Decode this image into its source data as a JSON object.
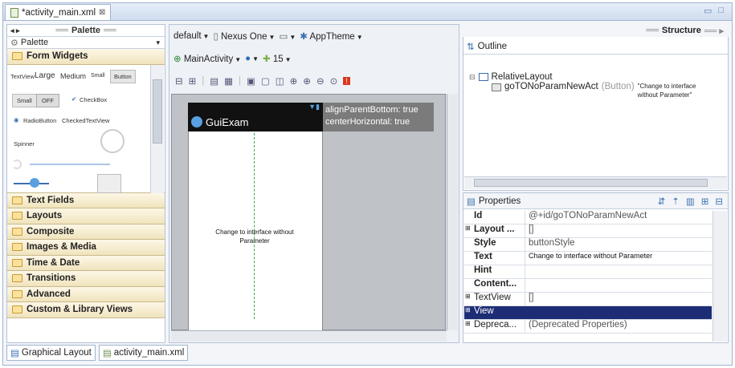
{
  "editor_tab": {
    "title": "*activity_main.xml",
    "close": "⊠"
  },
  "palette": {
    "header": "Palette",
    "selector": "Palette",
    "categories": [
      "Form Widgets",
      "Text Fields",
      "Layouts",
      "Composite",
      "Images & Media",
      "Time & Date",
      "Transitions",
      "Advanced",
      "Custom & Library Views"
    ],
    "widgets": {
      "textview": "TextView",
      "large": "Large",
      "medium": "Medium",
      "small": "Small",
      "button": "Button",
      "small_btn": "Small",
      "off": "OFF",
      "checkbox": "CheckBox",
      "radio": "RadioButton",
      "checked_tv": "CheckedTextView",
      "spinner": "Spinner"
    }
  },
  "toolbar": {
    "config": "default",
    "device": "Nexus One",
    "theme": "AppTheme",
    "activity": "MainActivity",
    "api": "15"
  },
  "canvas": {
    "app_title": "GuiExam",
    "hint_line1": "alignParentBottom: true",
    "hint_line2": "centerHorizontal: true",
    "button_text": "Change to interface without Parameter"
  },
  "structure": {
    "header": "Structure",
    "outline_title": "Outline",
    "root": "RelativeLayout",
    "child_name": "goTONoParamNewAct",
    "child_type": "(Button)",
    "child_text": "\"Change to interface without Parameter\""
  },
  "properties": {
    "title": "Properties",
    "rows": [
      {
        "key": "Id",
        "value": "@+id/goTONoParamNewAct"
      },
      {
        "key": "Layout ...",
        "value": "[]"
      },
      {
        "key": "Style",
        "value": "buttonStyle"
      },
      {
        "key": "Text",
        "value": "Change to interface without Parameter"
      },
      {
        "key": "Hint",
        "value": ""
      },
      {
        "key": "Content...",
        "value": ""
      },
      {
        "key": "TextView",
        "value": "[]"
      },
      {
        "key": "View",
        "value": ""
      },
      {
        "key": "Depreca...",
        "value": "(Deprecated Properties)"
      }
    ]
  },
  "bottom_tabs": [
    "Graphical Layout",
    "activity_main.xml"
  ],
  "colors": {
    "selected_row": "#1c2d75",
    "accent": "#3a6fb0"
  }
}
